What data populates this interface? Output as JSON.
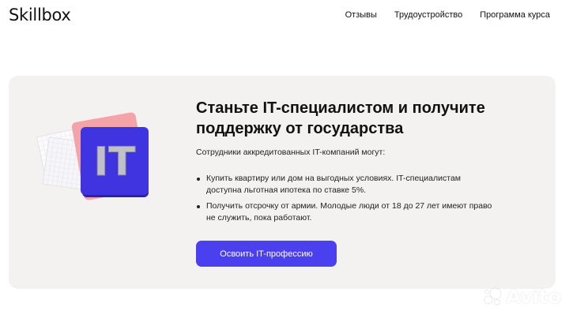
{
  "header": {
    "logo": "Skillbox",
    "nav": [
      "Отзывы",
      "Трудоустройство",
      "Программа курса"
    ]
  },
  "promo": {
    "title": "Станьте IT-специалистом и получите поддержку от государства",
    "lead": "Сотрудники аккредитованных IT-компаний могут:",
    "bullets": [
      "Купить квартиру или дом на выгодных условиях. IT-специалистам доступна льготная ипотека по ставке 5%.",
      "Получить отсрочку от армии. Молодые люди от 18 до 27 лет имеют право не служить, пока работают."
    ],
    "cta": "Освоить IT-профессию",
    "badge_text": "IT"
  },
  "watermark": "Avito",
  "colors": {
    "accent": "#4b40f0",
    "card_bg": "#f3f2f0",
    "pink": "#f4a3a8",
    "badge_blue": "#3f34e0"
  }
}
